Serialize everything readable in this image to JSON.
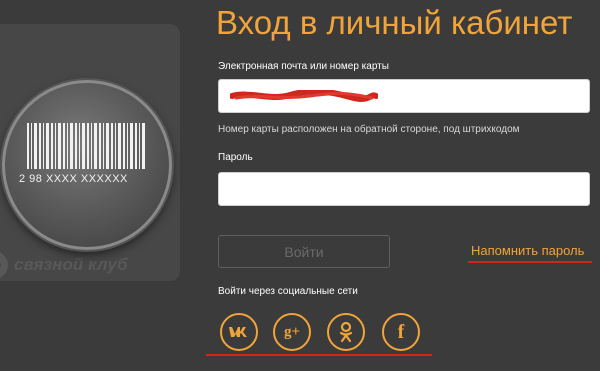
{
  "title": "Вход в личный кабинет",
  "form": {
    "email_label": "Электронная почта или номер карты",
    "email_value": "",
    "card_hint": "Номер карты расположен на обратной стороне, под штрихкодом",
    "password_label": "Пароль",
    "password_value": "",
    "login_button": "Войти",
    "remind_link": "Напомнить пароль",
    "social_label": "Войти через социальные сети"
  },
  "card": {
    "barcode_number": "2 98 XXXX XXXXXX",
    "logo_text": "связной клуб"
  },
  "social": [
    {
      "icon": "vk-icon",
      "glyph": "vk"
    },
    {
      "icon": "google-plus-icon",
      "glyph": "g+"
    },
    {
      "icon": "odnoklassniki-icon",
      "glyph": "ok"
    },
    {
      "icon": "facebook-icon",
      "glyph": "f"
    }
  ],
  "colors": {
    "accent": "#f0a43a",
    "background": "#3b3b3b",
    "annotation_red": "#d0261c"
  }
}
